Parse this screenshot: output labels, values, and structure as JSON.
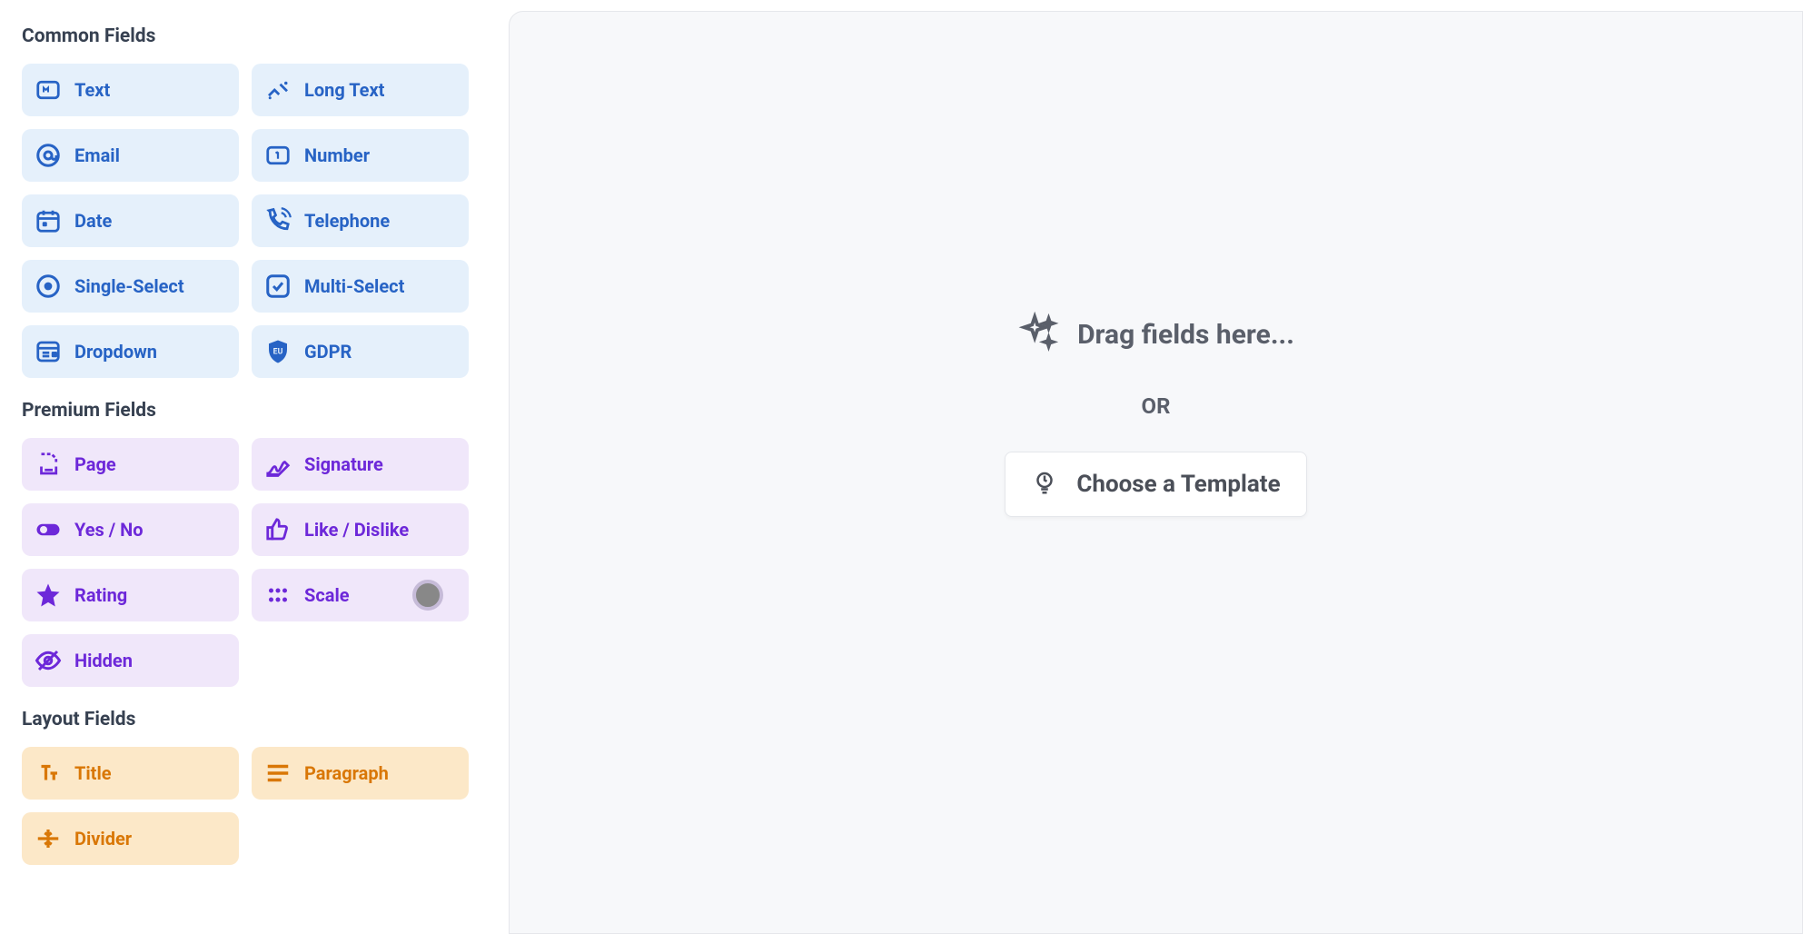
{
  "sections": {
    "common": {
      "title": "Common Fields"
    },
    "premium": {
      "title": "Premium Fields"
    },
    "layout": {
      "title": "Layout Fields"
    }
  },
  "common_fields": [
    {
      "label": "Text"
    },
    {
      "label": "Long Text"
    },
    {
      "label": "Email"
    },
    {
      "label": "Number"
    },
    {
      "label": "Date"
    },
    {
      "label": "Telephone"
    },
    {
      "label": "Single-Select"
    },
    {
      "label": "Multi-Select"
    },
    {
      "label": "Dropdown"
    },
    {
      "label": "GDPR"
    }
  ],
  "premium_fields": [
    {
      "label": "Page"
    },
    {
      "label": "Signature"
    },
    {
      "label": "Yes / No"
    },
    {
      "label": "Like / Dislike"
    },
    {
      "label": "Rating"
    },
    {
      "label": "Scale"
    },
    {
      "label": "Hidden"
    }
  ],
  "layout_fields": [
    {
      "label": "Title"
    },
    {
      "label": "Paragraph"
    },
    {
      "label": "Divider"
    }
  ],
  "canvas": {
    "drop_hint": "Drag fields here...",
    "or": "OR",
    "template_button": "Choose a Template"
  }
}
